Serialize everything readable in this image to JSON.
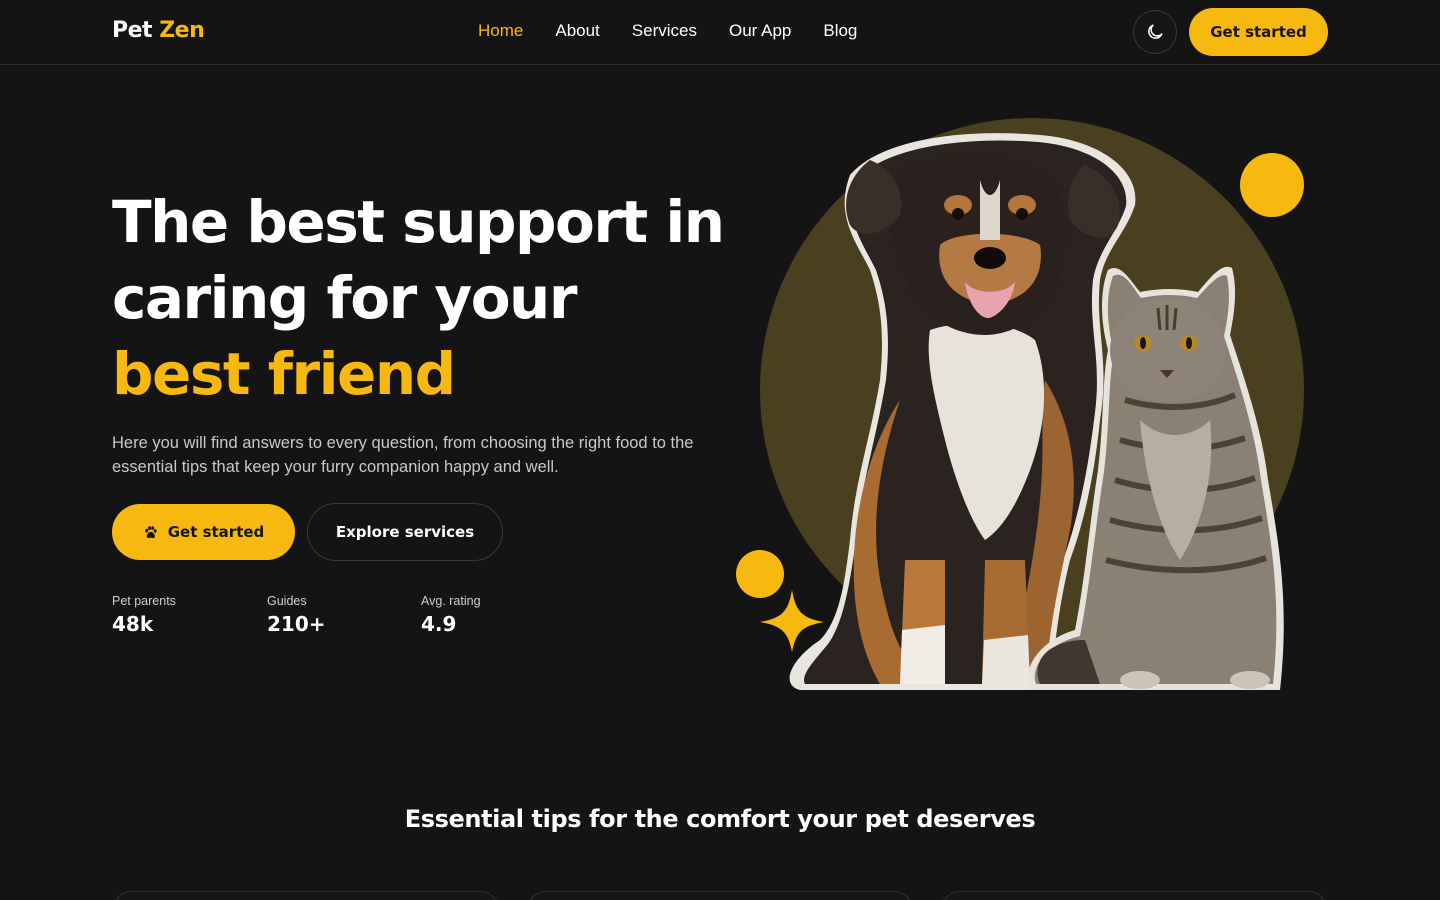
{
  "brand": {
    "name_part1": "Pet",
    "name_part2": "Zen",
    "accent_color": "#f7b90f"
  },
  "nav": {
    "items": [
      {
        "label": "Home",
        "active": true
      },
      {
        "label": "About",
        "active": false
      },
      {
        "label": "Services",
        "active": false
      },
      {
        "label": "Our App",
        "active": false
      },
      {
        "label": "Blog",
        "active": false
      }
    ]
  },
  "header": {
    "theme_icon": "moon-icon",
    "cta_label": "Get started"
  },
  "hero": {
    "title_line1": "The best support in",
    "title_line2": "caring for your",
    "title_accent": "best friend",
    "description": "Here you will find answers to every question, from choosing the right food to the essential tips that keep your furry companion happy and well.",
    "primary_cta": "Get started",
    "primary_cta_icon": "paw-icon",
    "secondary_cta": "Explore services",
    "stats": [
      {
        "label": "Pet parents",
        "value": "48k"
      },
      {
        "label": "Guides",
        "value": "210+"
      },
      {
        "label": "Avg. rating",
        "value": "4.9"
      }
    ]
  },
  "tips": {
    "title": "Essential tips for the comfort your pet deserves"
  },
  "colors": {
    "background": "#141414",
    "accent": "#f7b90f",
    "circle_backdrop": "#4a3f1f"
  }
}
